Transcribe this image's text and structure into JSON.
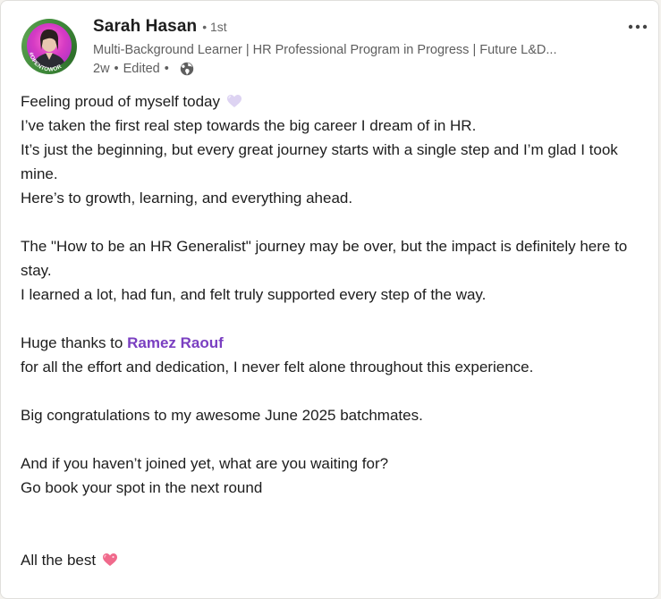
{
  "author": {
    "name": "Sarah Hasan",
    "degree": "• 1st",
    "headline": "Multi-Background Learner | HR Professional Program in Progress | Future L&D...",
    "time": "2w",
    "separator": "•",
    "edited": "Edited",
    "separator2": "•",
    "avatar_badge": "#OPENTOWORK",
    "visibility_icon": "globe-icon"
  },
  "menu": {
    "more_icon": "more-horizontal-icon"
  },
  "post": {
    "lines": [
      "Feeling proud of myself today",
      "I’ve taken the first real step towards the big career I dream of in HR.",
      "It’s just the beginning, but every great journey starts with a single step and I’m glad I took mine.",
      "Here’s to growth, learning, and everything ahead.",
      "The \"How to be an HR Generalist\" journey may be over, but the impact is definitely here to stay.",
      "I learned a lot, had fun, and felt truly supported every step of the way.",
      "Huge thanks to",
      "for all the effort and dedication, I never felt alone throughout this experience.",
      "Big congratulations to my awesome June 2025 batchmates.",
      "And if you haven’t joined yet, what are you waiting for?",
      "Go book your spot in the next round",
      "All the best"
    ],
    "mention": "Ramez Raouf",
    "emoji_1": "purple-heart-icon",
    "emoji_2": "sparkling-heart-icon"
  },
  "colors": {
    "mention": "#7a3fc1",
    "text": "#1d1d1d",
    "secondary_text": "#5e5e5e",
    "opentowork_ring": "#3f8a3a"
  }
}
